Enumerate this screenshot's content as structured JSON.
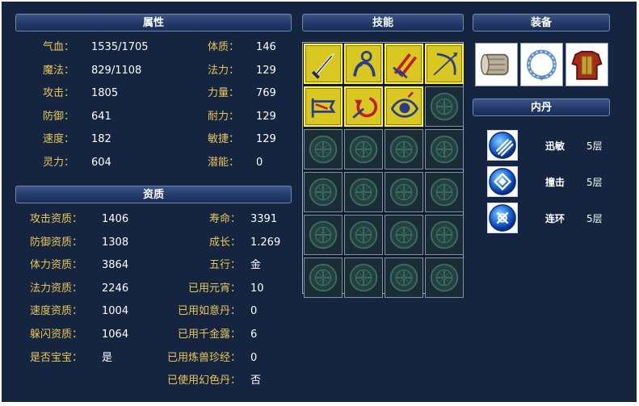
{
  "panels": {
    "attributes_title": "属性",
    "aptitude_title": "资质",
    "skills_title": "技能",
    "equipment_title": "装备",
    "neidan_title": "内丹"
  },
  "attributes": {
    "left": [
      {
        "label": "气血：",
        "value": "1535/1705"
      },
      {
        "label": "魔法：",
        "value": "829/1108"
      },
      {
        "label": "攻击：",
        "value": "1805"
      },
      {
        "label": "防御：",
        "value": "641"
      },
      {
        "label": "速度：",
        "value": "182"
      },
      {
        "label": "灵力：",
        "value": "604"
      }
    ],
    "right": [
      {
        "label": "体质：",
        "value": "146"
      },
      {
        "label": "法力：",
        "value": "129"
      },
      {
        "label": "力量：",
        "value": "769"
      },
      {
        "label": "耐力：",
        "value": "129"
      },
      {
        "label": "敏捷：",
        "value": "129"
      },
      {
        "label": "潜能：",
        "value": "0"
      }
    ]
  },
  "aptitude": {
    "left": [
      {
        "label": "攻击资质：",
        "value": "1406"
      },
      {
        "label": "防御资质：",
        "value": "1308"
      },
      {
        "label": "体力资质：",
        "value": "3864"
      },
      {
        "label": "法力资质：",
        "value": "2246"
      },
      {
        "label": "速度资质：",
        "value": "1004"
      },
      {
        "label": "躲闪资质：",
        "value": "1064"
      },
      {
        "label": "是否宝宝：",
        "value": "是"
      }
    ],
    "right": [
      {
        "label": "寿命：",
        "value": "3391"
      },
      {
        "label": "成长：",
        "value": "1.269"
      },
      {
        "label": "五行：",
        "value": "金"
      },
      {
        "label": "已用元宵：",
        "value": "10"
      },
      {
        "label": "已用如意丹：",
        "value": "0"
      },
      {
        "label": "已用千金露：",
        "value": "6"
      },
      {
        "label": "已用炼兽珍经：",
        "value": "0"
      },
      {
        "label": "已使用幻色丹：",
        "value": "否"
      }
    ]
  },
  "skills": [
    {
      "icon": "sword-skill-icon",
      "active": true
    },
    {
      "icon": "figure-skill-icon",
      "active": true
    },
    {
      "icon": "double-sword-skill-icon",
      "active": true
    },
    {
      "icon": "bow-skill-icon",
      "active": true
    },
    {
      "icon": "pennant-skill-icon",
      "active": true
    },
    {
      "icon": "counter-arrow-skill-icon",
      "active": true
    },
    {
      "icon": "eye-skill-icon",
      "active": true
    }
  ],
  "equipment": [
    {
      "icon": "bracer-icon"
    },
    {
      "icon": "collar-ring-icon"
    },
    {
      "icon": "armor-icon"
    }
  ],
  "neidan": [
    {
      "icon": "claw-orb-icon",
      "name": "迅敏",
      "level": "5层"
    },
    {
      "icon": "diamond-orb-icon",
      "name": "撞击",
      "level": "5层"
    },
    {
      "icon": "chain-orb-icon",
      "name": "连环",
      "level": "5层"
    }
  ],
  "colors": {
    "background": "#15253f",
    "label": "#e8c65a",
    "value": "#ffffff",
    "skill_active": "#d9c722",
    "header": "#233a6a"
  }
}
